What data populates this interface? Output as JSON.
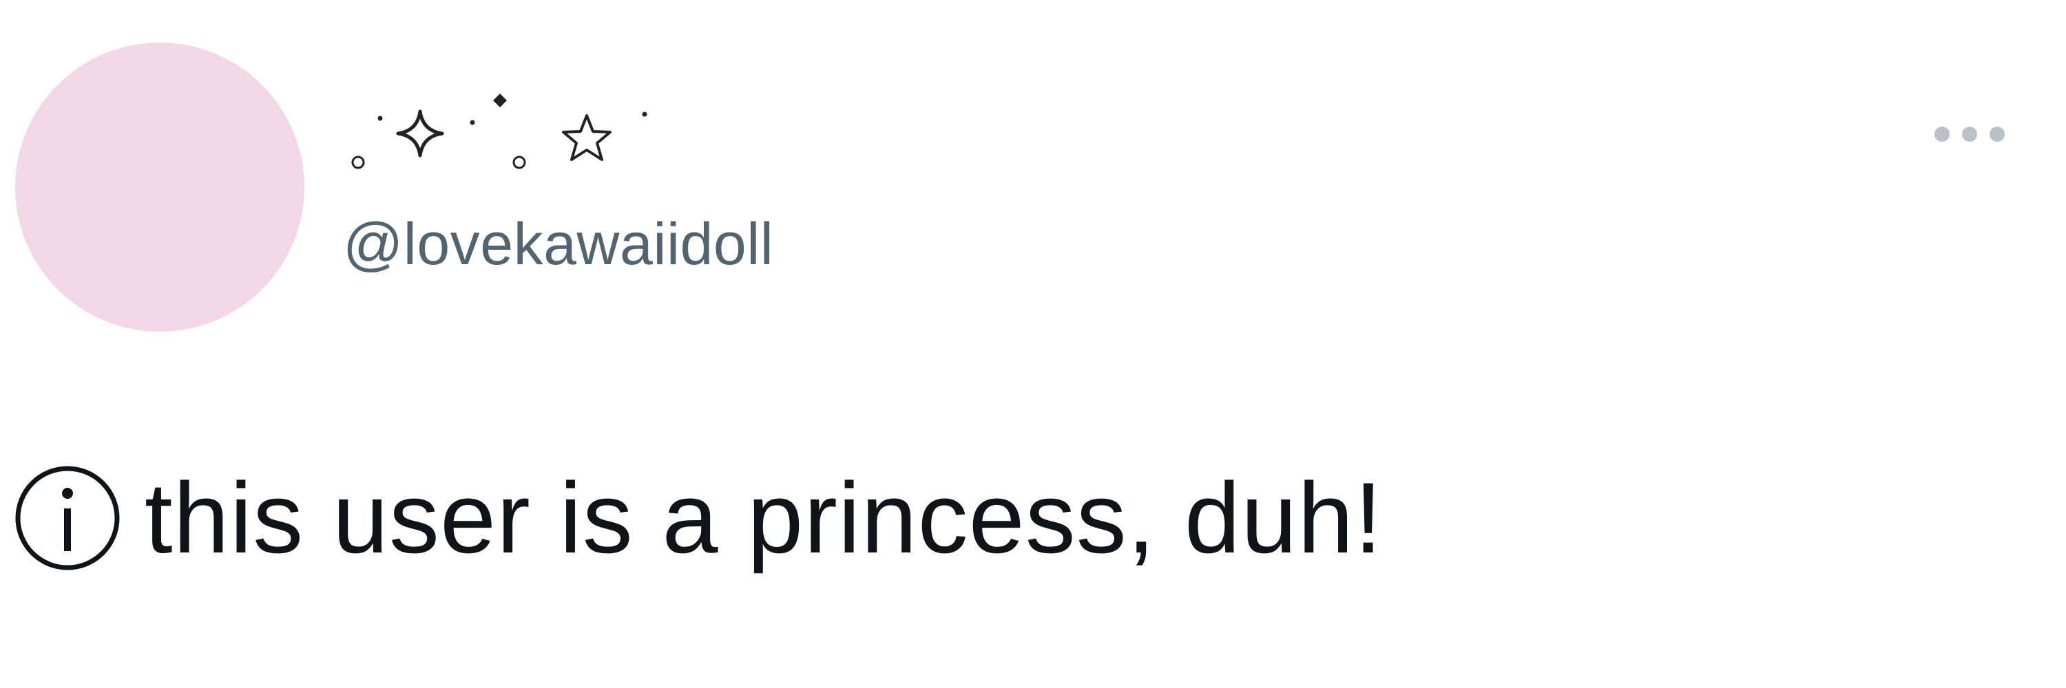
{
  "profile": {
    "display_name": "˚.✧˚.°.☆˚",
    "handle": "@lovekawaiidoll",
    "bio": "this user is a princess, duh!",
    "avatar_color": "#f2d7e7"
  },
  "icons": {
    "more": "more-options-icon",
    "info": "info-icon"
  },
  "colors": {
    "text_primary": "#0f1419",
    "text_secondary": "#536471",
    "more_dots": "#b8c2ca"
  }
}
